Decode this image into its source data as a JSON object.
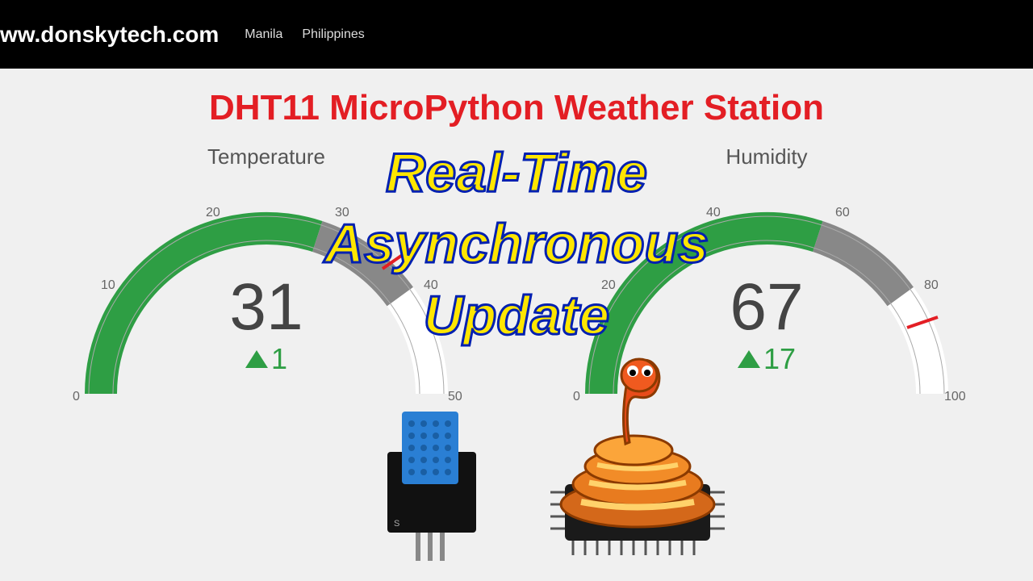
{
  "topbar": {
    "site_url": "ww.donskytech.com",
    "nav": [
      "Manila",
      "Philippines"
    ]
  },
  "page_title": "DHT11 MicroPython Weather Station",
  "overlay": {
    "line1": "Real-Time",
    "line2": "Asynchronous",
    "line3": "Update"
  },
  "gauges": {
    "temperature": {
      "title": "Temperature",
      "value": "31",
      "delta": "1",
      "ticks": [
        "0",
        "10",
        "20",
        "30",
        "40",
        "50"
      ],
      "range_min": 0,
      "range_max": 50,
      "green_end": 30,
      "grey_end": 40
    },
    "humidity": {
      "title": "Humidity",
      "value": "67",
      "delta": "17",
      "ticks": [
        "0",
        "20",
        "40",
        "60",
        "80",
        "100"
      ],
      "range_min": 0,
      "range_max": 100,
      "green_end": 60,
      "grey_end": 80
    }
  },
  "chart_data": [
    {
      "type": "gauge",
      "title": "Temperature",
      "value": 31,
      "delta": 1,
      "range": [
        0,
        50
      ],
      "steps": [
        {
          "range": [
            0,
            30
          ],
          "color": "green"
        },
        {
          "range": [
            30,
            40
          ],
          "color": "gray"
        },
        {
          "range": [
            40,
            50
          ],
          "color": "white"
        }
      ],
      "ticks": [
        0,
        10,
        20,
        30,
        40,
        50
      ]
    },
    {
      "type": "gauge",
      "title": "Humidity",
      "value": 67,
      "delta": 17,
      "range": [
        0,
        100
      ],
      "steps": [
        {
          "range": [
            0,
            60
          ],
          "color": "green"
        },
        {
          "range": [
            60,
            80
          ],
          "color": "gray"
        },
        {
          "range": [
            80,
            100
          ],
          "color": "white"
        }
      ],
      "ticks": [
        0,
        20,
        40,
        60,
        80,
        100
      ]
    }
  ]
}
